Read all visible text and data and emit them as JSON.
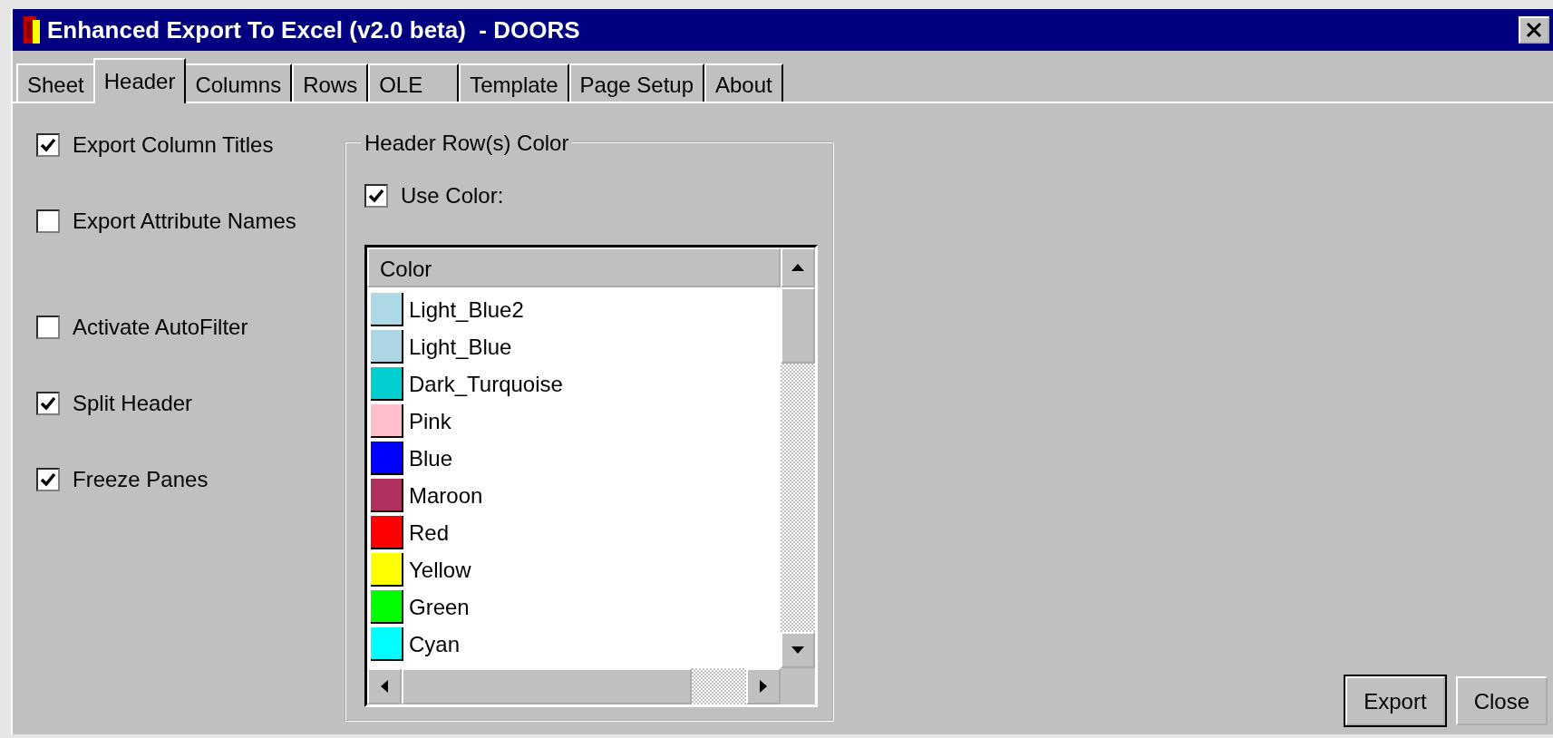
{
  "window": {
    "title": "Enhanced Export To Excel (v2.0 beta)  - DOORS"
  },
  "tabs": [
    {
      "label": "Sheet",
      "selected": false
    },
    {
      "label": "Header",
      "selected": true
    },
    {
      "label": "Columns",
      "selected": false
    },
    {
      "label": "Rows",
      "selected": false
    },
    {
      "label": "OLE",
      "selected": false
    },
    {
      "label": "Template",
      "selected": false
    },
    {
      "label": "Page Setup",
      "selected": false
    },
    {
      "label": "About",
      "selected": false
    }
  ],
  "options": [
    {
      "label": "Export Column Titles",
      "checked": true
    },
    {
      "label": "Export Attribute Names",
      "checked": false
    },
    {
      "label": "Activate AutoFilter",
      "checked": false
    },
    {
      "label": "Split Header",
      "checked": true
    },
    {
      "label": "Freeze Panes",
      "checked": true
    }
  ],
  "header_color": {
    "title": "Header Row(s) Color",
    "use_color": {
      "label": "Use Color:",
      "checked": true
    },
    "list": {
      "column": "Color",
      "items": [
        {
          "name": "Light_Blue2",
          "color": "#add8e6"
        },
        {
          "name": "Light_Blue",
          "color": "#acd6e4"
        },
        {
          "name": "Dark_Turquoise",
          "color": "#00ced1"
        },
        {
          "name": "Pink",
          "color": "#ffc0cb"
        },
        {
          "name": "Blue",
          "color": "#0000ff"
        },
        {
          "name": "Maroon",
          "color": "#b03060"
        },
        {
          "name": "Red",
          "color": "#ff0000"
        },
        {
          "name": "Yellow",
          "color": "#ffff00"
        },
        {
          "name": "Green",
          "color": "#00ff00"
        },
        {
          "name": "Cyan",
          "color": "#00ffff"
        }
      ]
    }
  },
  "buttons": [
    "Export",
    "Close"
  ]
}
